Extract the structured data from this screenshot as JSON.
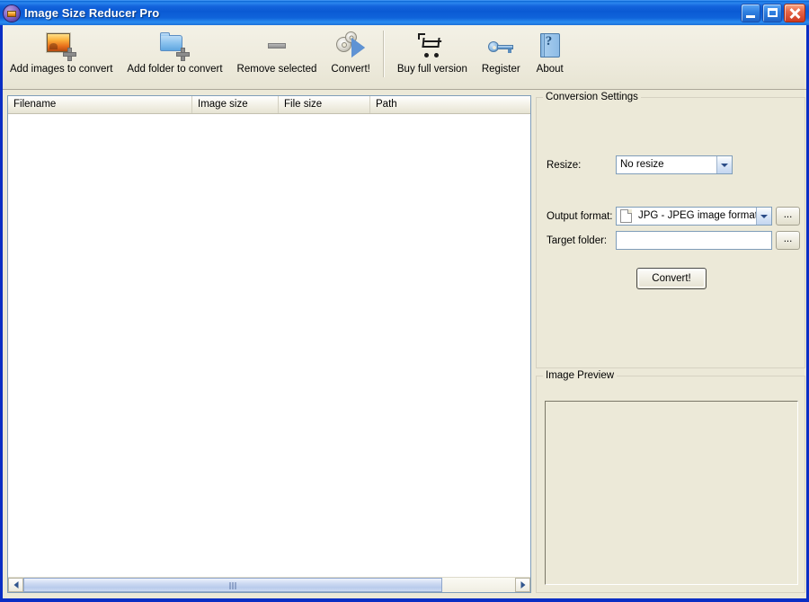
{
  "window": {
    "title": "Image Size Reducer Pro",
    "icon": "app-image-icon",
    "controls": {
      "minimize": "minimize-button",
      "maximize": "maximize-button",
      "close": "close-button"
    }
  },
  "toolbar": {
    "items": [
      {
        "label": "Add images to convert",
        "icon": "add-image-icon"
      },
      {
        "label": "Add folder to convert",
        "icon": "add-folder-icon"
      },
      {
        "label": "Remove selected",
        "icon": "remove-icon"
      },
      {
        "label": "Convert!",
        "icon": "gears-convert-icon"
      },
      {
        "label": "Buy full version",
        "icon": "shopping-cart-icon"
      },
      {
        "label": "Register",
        "icon": "key-icon"
      },
      {
        "label": "About",
        "icon": "help-book-icon"
      }
    ]
  },
  "file_list": {
    "columns": [
      "Filename",
      "Image size",
      "File size",
      "Path"
    ],
    "rows": [],
    "scrollbar": {
      "left_arrow": "◀",
      "right_arrow": "▶"
    }
  },
  "settings": {
    "group_title": "Conversion Settings",
    "resize": {
      "label": "Resize:",
      "value": "No resize"
    },
    "output_format": {
      "label": "Output format:",
      "value": "JPG - JPEG image format",
      "browse_label": "..."
    },
    "target_folder": {
      "label": "Target folder:",
      "value": "",
      "placeholder": "",
      "browse_label": "..."
    },
    "convert_button": "Convert!"
  },
  "preview": {
    "group_title": "Image Preview",
    "content": ""
  },
  "colors": {
    "titlebar_blue": "#0a5ad4",
    "window_face": "#ece9d8",
    "close_red": "#cc3a22",
    "list_background": "#ffffff",
    "field_border": "#7f9db9"
  }
}
